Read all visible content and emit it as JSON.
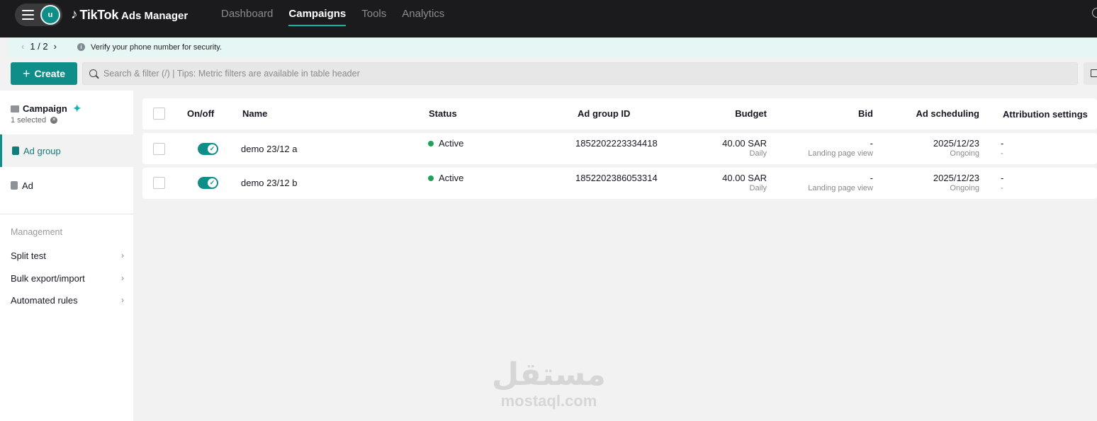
{
  "topbar": {
    "avatar_initial": "u",
    "logo_brand": "TikTok",
    "logo_product": "Ads Manager",
    "nav": [
      {
        "label": "Dashboard",
        "active": false
      },
      {
        "label": "Campaigns",
        "active": true
      },
      {
        "label": "Tools",
        "active": false
      },
      {
        "label": "Analytics",
        "active": false
      }
    ]
  },
  "notice": {
    "pager": "1 / 2",
    "text": "Verify your phone number for security."
  },
  "toolbar": {
    "create_label": "Create",
    "search_placeholder": "Search & filter (/) | Tips: Metric filters are available in table header"
  },
  "sidebar": {
    "campaign_label": "Campaign",
    "selected_text": "1 selected",
    "items": [
      {
        "label": "Ad group",
        "active": true
      },
      {
        "label": "Ad",
        "active": false
      }
    ],
    "management_title": "Management",
    "links": [
      {
        "label": "Split test"
      },
      {
        "label": "Bulk export/import"
      },
      {
        "label": "Automated rules"
      }
    ]
  },
  "table": {
    "headers": {
      "onoff": "On/off",
      "name": "Name",
      "status": "Status",
      "ad_group_id": "Ad group ID",
      "budget": "Budget",
      "bid": "Bid",
      "ad_scheduling": "Ad scheduling",
      "attribution": "Attribution settings"
    },
    "rows": [
      {
        "name": "demo 23/12 a",
        "status": "Active",
        "ad_group_id": "1852202223334418",
        "budget": "40.00 SAR",
        "budget_type": "Daily",
        "bid": "-",
        "bid_type": "Landing page view",
        "schedule_date": "2025/12/23",
        "schedule_status": "Ongoing",
        "attribution": "-",
        "attribution_sub": "-"
      },
      {
        "name": "demo 23/12 b",
        "status": "Active",
        "ad_group_id": "1852202386053314",
        "budget": "40.00 SAR",
        "budget_type": "Daily",
        "bid": "-",
        "bid_type": "Landing page view",
        "schedule_date": "2025/12/23",
        "schedule_status": "Ongoing",
        "attribution": "-",
        "attribution_sub": "-"
      }
    ]
  },
  "watermark": {
    "arabic": "مستقل",
    "latin": "mostaql.com"
  },
  "colors": {
    "accent": "#0f8e89",
    "topbar_bg": "#1b1b1d",
    "active_status": "#20a05c"
  }
}
